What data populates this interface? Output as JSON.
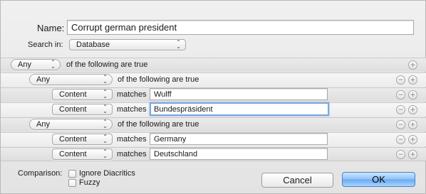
{
  "name_label": "Name:",
  "name_value": "Corrupt german president",
  "search_in_label": "Search in:",
  "search_in_value": "Database",
  "rows": [
    {
      "kind": "group",
      "level": 0,
      "quantifier": "Any",
      "text": "of the following are true"
    },
    {
      "kind": "group",
      "level": 1,
      "quantifier": "Any",
      "text": "of the following are true"
    },
    {
      "kind": "criterion",
      "field": "Content",
      "operator": "matches",
      "value": "Wulff"
    },
    {
      "kind": "criterion",
      "field": "Content",
      "operator": "matches",
      "value": "Bundespräsident"
    },
    {
      "kind": "group",
      "level": 1,
      "quantifier": "Any",
      "text": "of the following are true"
    },
    {
      "kind": "criterion",
      "field": "Content",
      "operator": "matches",
      "value": "Germany"
    },
    {
      "kind": "criterion",
      "field": "Content",
      "operator": "matches",
      "value": "Deutschland"
    }
  ],
  "comparison_label": "Comparison:",
  "ignore_diacritics_label": "Ignore Diacritics",
  "fuzzy_label": "Fuzzy",
  "cancel_label": "Cancel",
  "ok_label": "OK",
  "glyphs": {
    "plus": "+",
    "minus": "−",
    "updown": "⌃⌄"
  }
}
